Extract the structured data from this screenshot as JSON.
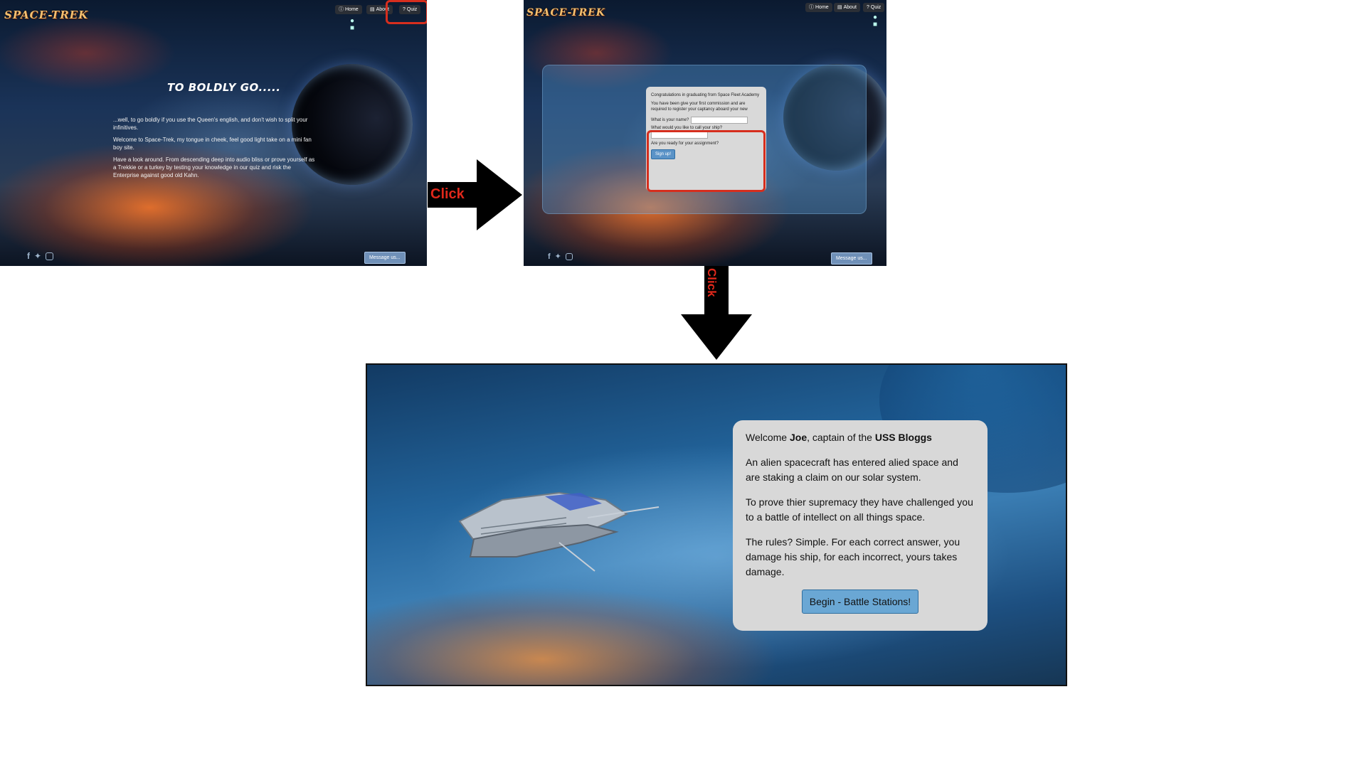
{
  "panel1": {
    "logo": "SPACE-TREK",
    "nav": {
      "home_label": "Home",
      "about_label": "About",
      "quiz_label": "Quiz"
    },
    "hero_title": "TO BOLDLY GO.....",
    "paragraphs": [
      "...well, to go boldly if you use the Queen's english, and don't wish to split your infinitives.",
      "Welcome to Space-Trek, my tongue in cheek, feel good light take on a mini fan boy site.",
      "Have a look around. From descending deep into audio bliss or prove yourself as a Trekkie or a turkey by testing your knowledge in our quiz and risk the Enterprise against good old Kahn."
    ],
    "message_button": "Message us..."
  },
  "arrow1_label": "Click",
  "arrow2_label": "Click",
  "panel2": {
    "logo": "SPACE-TREK",
    "nav": {
      "home_label": "Home",
      "about_label": "About",
      "quiz_label": "Quiz"
    },
    "modal": {
      "line1": "Congratulations in graduating from Space Fleet Academy",
      "line2": "You have been give your first commission and are required to register your captancy aboard your new vessel.",
      "name_label": "What is your name?",
      "ship_label": "What would you like to call your ship?",
      "ready_label": "Are you ready for your assignment?",
      "signup_button": "Sign up!"
    },
    "message_button": "Message us..."
  },
  "panel3": {
    "welcome_prefix": "Welcome ",
    "captain_name": "Joe",
    "welcome_middle": ", captain of the ",
    "ship_name": "USS Bloggs",
    "p1": "An alien spacecraft has entered alied space and are staking a claim on our solar system.",
    "p2": "To prove thier supremacy they have challenged you to a battle of intellect on all things space.",
    "p3": "The rules? Simple. For each correct answer, you damage his ship, for each incorrect, yours takes damage.",
    "begin_button": "Begin - Battle Stations!"
  },
  "icons": [
    "info-icon",
    "id-card-icon",
    "question-icon",
    "facebook-icon",
    "twitter-icon",
    "instagram-icon",
    "robot-icon"
  ],
  "colors": {
    "highlight_red": "#d62e1e",
    "button_blue": "#6aa7d4",
    "card_gray": "#d8d8d8"
  }
}
